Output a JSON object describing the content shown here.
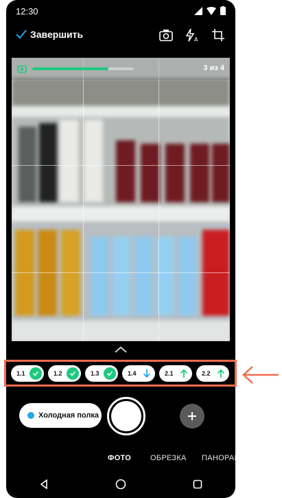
{
  "status": {
    "time": "12:30"
  },
  "toolbar": {
    "finish_label": "Завершить",
    "icons": [
      "checkmark-icon",
      "camera-switch-icon",
      "flash-auto-icon",
      "crop-icon"
    ]
  },
  "viewfinder": {
    "progress_text": "3 из 4",
    "progress_fraction": 0.75
  },
  "chips": [
    {
      "label": "1.1",
      "status": "done",
      "color": "#1ec97e"
    },
    {
      "label": "1.2",
      "status": "done",
      "color": "#1ec97e"
    },
    {
      "label": "1.3",
      "status": "done",
      "color": "#1ec97e"
    },
    {
      "label": "1.4",
      "status": "down",
      "color": "#27a5ea"
    },
    {
      "label": "2.1",
      "status": "up",
      "color": "#1ec97e"
    },
    {
      "label": "2.2",
      "status": "up",
      "color": "#1ec97e"
    }
  ],
  "category": {
    "label": "Холодная полка",
    "color": "#27a5ea"
  },
  "modes": {
    "photo": "ФОТО",
    "crop": "ОБРЕЗКА",
    "panorama": "ПАНОРАМА"
  },
  "colors": {
    "accent": "#1ec97e",
    "annotation": "#f26c4f",
    "info": "#27a5ea"
  }
}
